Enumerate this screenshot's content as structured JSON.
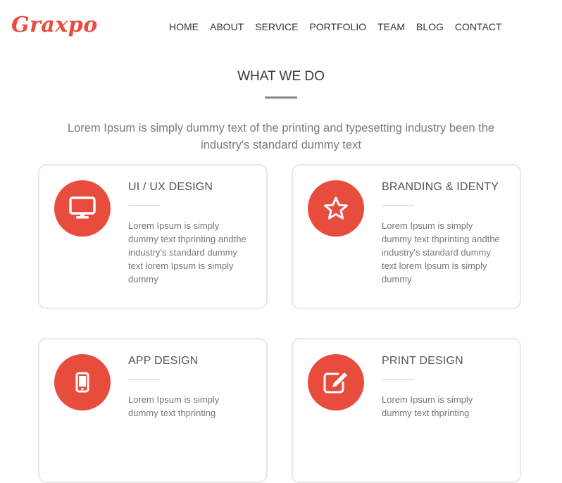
{
  "brand": {
    "logo": "Graxpo"
  },
  "nav": {
    "items": [
      "HOME",
      "ABOUT",
      "SERVICE",
      "PORTFOLIO",
      "TEAM",
      "BLOG",
      "CONTACT"
    ]
  },
  "section": {
    "title": "WHAT WE DO",
    "intro": "Lorem Ipsum is simply dummy text of the printing and typesetting industry been the industry's standard dummy text"
  },
  "services": [
    {
      "title": "UI / UX DESIGN",
      "icon": "monitor-icon",
      "text": "Lorem Ipsum is simply dummy text thprinting andthe industry's standard dummy text lorem Ipsum is simply dummy"
    },
    {
      "title": "BRANDING & IDENTY",
      "icon": "star-icon",
      "text": "Lorem Ipsum is simply dummy text thprinting andthe industry's standard dummy text lorem Ipsum is simply dummy"
    },
    {
      "title": "APP DESIGN",
      "icon": "mobile-icon",
      "text": "Lorem Ipsum is simply dummy text thprinting"
    },
    {
      "title": "PRINT DESIGN",
      "icon": "edit-icon",
      "text": "Lorem Ipsum is simply dummy text thprinting"
    }
  ],
  "colors": {
    "accent": "#e84c3d",
    "text": "#333333",
    "muted": "#777777",
    "border": "#e8e8e8"
  }
}
